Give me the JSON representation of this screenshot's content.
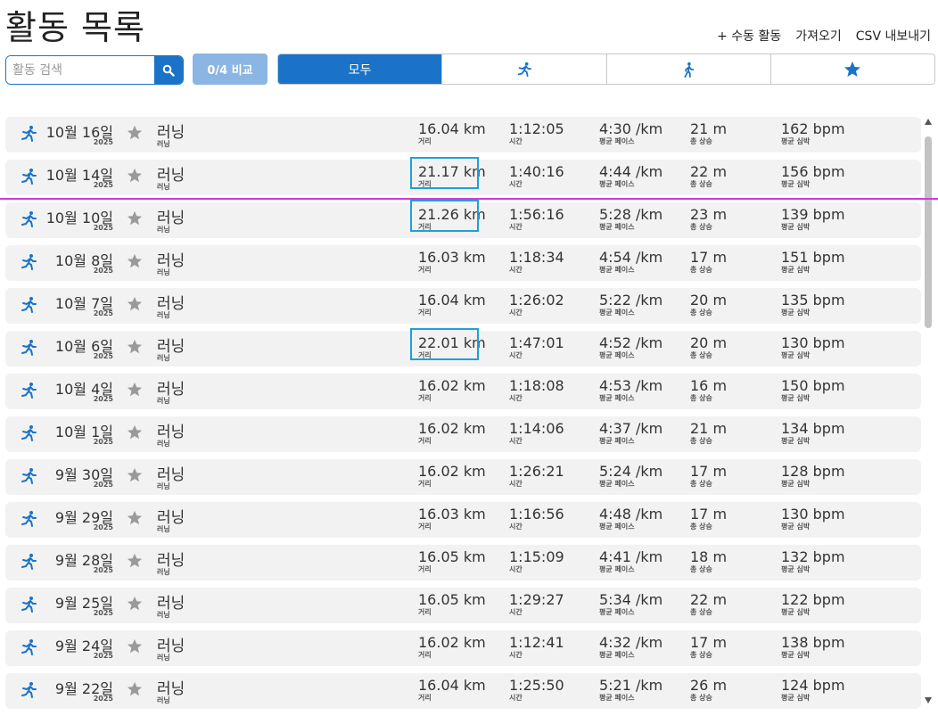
{
  "page": {
    "title": "활동 목록"
  },
  "actions": {
    "manual": "+ 수동 활동",
    "import": "가져오기",
    "export": "CSV 내보내기"
  },
  "search": {
    "placeholder": "활동 검색",
    "value": ""
  },
  "compare": {
    "label": "0/4 비교"
  },
  "filters": [
    {
      "label": "모두",
      "icon": "",
      "active": true
    },
    {
      "label": "",
      "icon": "running-icon",
      "active": false
    },
    {
      "label": "",
      "icon": "walking-icon",
      "active": false
    },
    {
      "label": "",
      "icon": "star-icon",
      "active": false
    }
  ],
  "labels": {
    "distance": "거리",
    "time": "시간",
    "pace": "평균 페이스",
    "elev": "총 상승",
    "hr": "평균 심박"
  },
  "colors": {
    "accent": "#1a73c8",
    "highlight": "#1ea0d8",
    "guide": "#d23ad6"
  },
  "activities": [
    {
      "date": "10월 16일",
      "year": "2025",
      "type": "러닝",
      "type_sub": "러닝",
      "distance": "16.04 km",
      "time": "1:12:05",
      "pace": "4:30 /km",
      "elev": "21 m",
      "hr": "162 bpm",
      "highlight": false
    },
    {
      "date": "10월 14일",
      "year": "2025",
      "type": "러닝",
      "type_sub": "러닝",
      "distance": "21.17 km",
      "time": "1:40:16",
      "pace": "4:44 /km",
      "elev": "22 m",
      "hr": "156 bpm",
      "highlight": true
    },
    {
      "date": "10월 10일",
      "year": "2025",
      "type": "러닝",
      "type_sub": "러닝",
      "distance": "21.26 km",
      "time": "1:56:16",
      "pace": "5:28 /km",
      "elev": "23 m",
      "hr": "139 bpm",
      "highlight": true
    },
    {
      "date": "10월 8일",
      "year": "2025",
      "type": "러닝",
      "type_sub": "러닝",
      "distance": "16.03 km",
      "time": "1:18:34",
      "pace": "4:54 /km",
      "elev": "17 m",
      "hr": "151 bpm",
      "highlight": false
    },
    {
      "date": "10월 7일",
      "year": "2025",
      "type": "러닝",
      "type_sub": "러닝",
      "distance": "16.04 km",
      "time": "1:26:02",
      "pace": "5:22 /km",
      "elev": "20 m",
      "hr": "135 bpm",
      "highlight": false
    },
    {
      "date": "10월 6일",
      "year": "2025",
      "type": "러닝",
      "type_sub": "러닝",
      "distance": "22.01 km",
      "time": "1:47:01",
      "pace": "4:52 /km",
      "elev": "20 m",
      "hr": "130 bpm",
      "highlight": true
    },
    {
      "date": "10월 4일",
      "year": "2025",
      "type": "러닝",
      "type_sub": "러닝",
      "distance": "16.02 km",
      "time": "1:18:08",
      "pace": "4:53 /km",
      "elev": "16 m",
      "hr": "150 bpm",
      "highlight": false
    },
    {
      "date": "10월 1일",
      "year": "2025",
      "type": "러닝",
      "type_sub": "러닝",
      "distance": "16.02 km",
      "time": "1:14:06",
      "pace": "4:37 /km",
      "elev": "21 m",
      "hr": "134 bpm",
      "highlight": false
    },
    {
      "date": "9월 30일",
      "year": "2025",
      "type": "러닝",
      "type_sub": "러닝",
      "distance": "16.02 km",
      "time": "1:26:21",
      "pace": "5:24 /km",
      "elev": "17 m",
      "hr": "128 bpm",
      "highlight": false
    },
    {
      "date": "9월 29일",
      "year": "2025",
      "type": "러닝",
      "type_sub": "러닝",
      "distance": "16.03 km",
      "time": "1:16:56",
      "pace": "4:48 /km",
      "elev": "17 m",
      "hr": "130 bpm",
      "highlight": false
    },
    {
      "date": "9월 28일",
      "year": "2025",
      "type": "러닝",
      "type_sub": "러닝",
      "distance": "16.05 km",
      "time": "1:15:09",
      "pace": "4:41 /km",
      "elev": "18 m",
      "hr": "132 bpm",
      "highlight": false
    },
    {
      "date": "9월 25일",
      "year": "2025",
      "type": "러닝",
      "type_sub": "러닝",
      "distance": "16.05 km",
      "time": "1:29:27",
      "pace": "5:34 /km",
      "elev": "22 m",
      "hr": "122 bpm",
      "highlight": false
    },
    {
      "date": "9월 24일",
      "year": "2025",
      "type": "러닝",
      "type_sub": "러닝",
      "distance": "16.02 km",
      "time": "1:12:41",
      "pace": "4:32 /km",
      "elev": "17 m",
      "hr": "138 bpm",
      "highlight": false
    },
    {
      "date": "9월 22일",
      "year": "2025",
      "type": "러닝",
      "type_sub": "러닝",
      "distance": "16.04 km",
      "time": "1:25:50",
      "pace": "5:21 /km",
      "elev": "26 m",
      "hr": "124 bpm",
      "highlight": false
    }
  ]
}
